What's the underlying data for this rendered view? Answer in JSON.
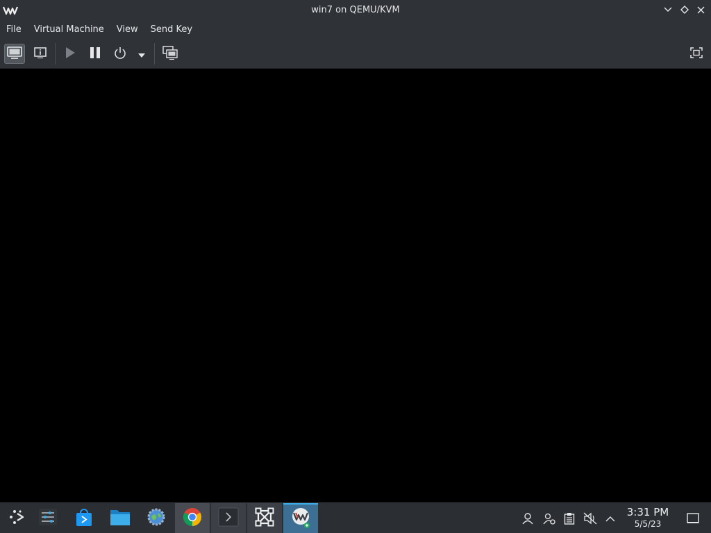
{
  "window": {
    "title": "win7 on QEMU/KVM",
    "app_logo_icon": "virt-manager-logo-icon",
    "controls": [
      "minimize-icon",
      "maximize-icon",
      "close-icon"
    ]
  },
  "menubar": {
    "items": [
      {
        "label": "File"
      },
      {
        "label": "Virtual Machine"
      },
      {
        "label": "View"
      },
      {
        "label": "Send Key"
      }
    ]
  },
  "toolbar": {
    "buttons": [
      {
        "icon": "console-display-icon",
        "state": "active"
      },
      {
        "icon": "details-info-icon"
      },
      {
        "icon": "run-play-icon",
        "state": "disabled"
      },
      {
        "icon": "pause-icon"
      },
      {
        "icon": "shutdown-power-icon"
      },
      {
        "icon": "shutdown-menu-arrow-icon"
      },
      {
        "icon": "snapshots-icon"
      },
      {
        "icon": "fullscreen-icon"
      }
    ]
  },
  "console": {
    "background": "#000000"
  },
  "taskbar": {
    "launchers": [
      {
        "icon": "application-launcher-icon"
      },
      {
        "icon": "system-settings-sliders-icon"
      },
      {
        "icon": "discover-store-icon"
      },
      {
        "icon": "file-manager-folder-icon"
      },
      {
        "icon": "settings-gear-globe-icon"
      },
      {
        "icon": "chrome-browser-icon",
        "state": "running"
      },
      {
        "icon": "terminal-icon",
        "state": "running"
      },
      {
        "icon": "kwin-window-icon",
        "state": "running"
      },
      {
        "icon": "virt-manager-icon",
        "state": "active"
      }
    ],
    "tray": [
      {
        "icon": "user-icon"
      },
      {
        "icon": "user-switch-icon"
      },
      {
        "icon": "clipboard-icon"
      },
      {
        "icon": "volume-muted-icon"
      },
      {
        "icon": "show-hidden-chevron-up-icon"
      }
    ],
    "clock": {
      "time": "3:31 PM",
      "date": "5/5/23"
    },
    "show_desktop_icon": "show-desktop-icon"
  },
  "colors": {
    "chrome_bg": "#2f3338",
    "taskbar_bg": "#2b2e33",
    "accent": "#3daee9",
    "text": "#e6e7e8"
  }
}
